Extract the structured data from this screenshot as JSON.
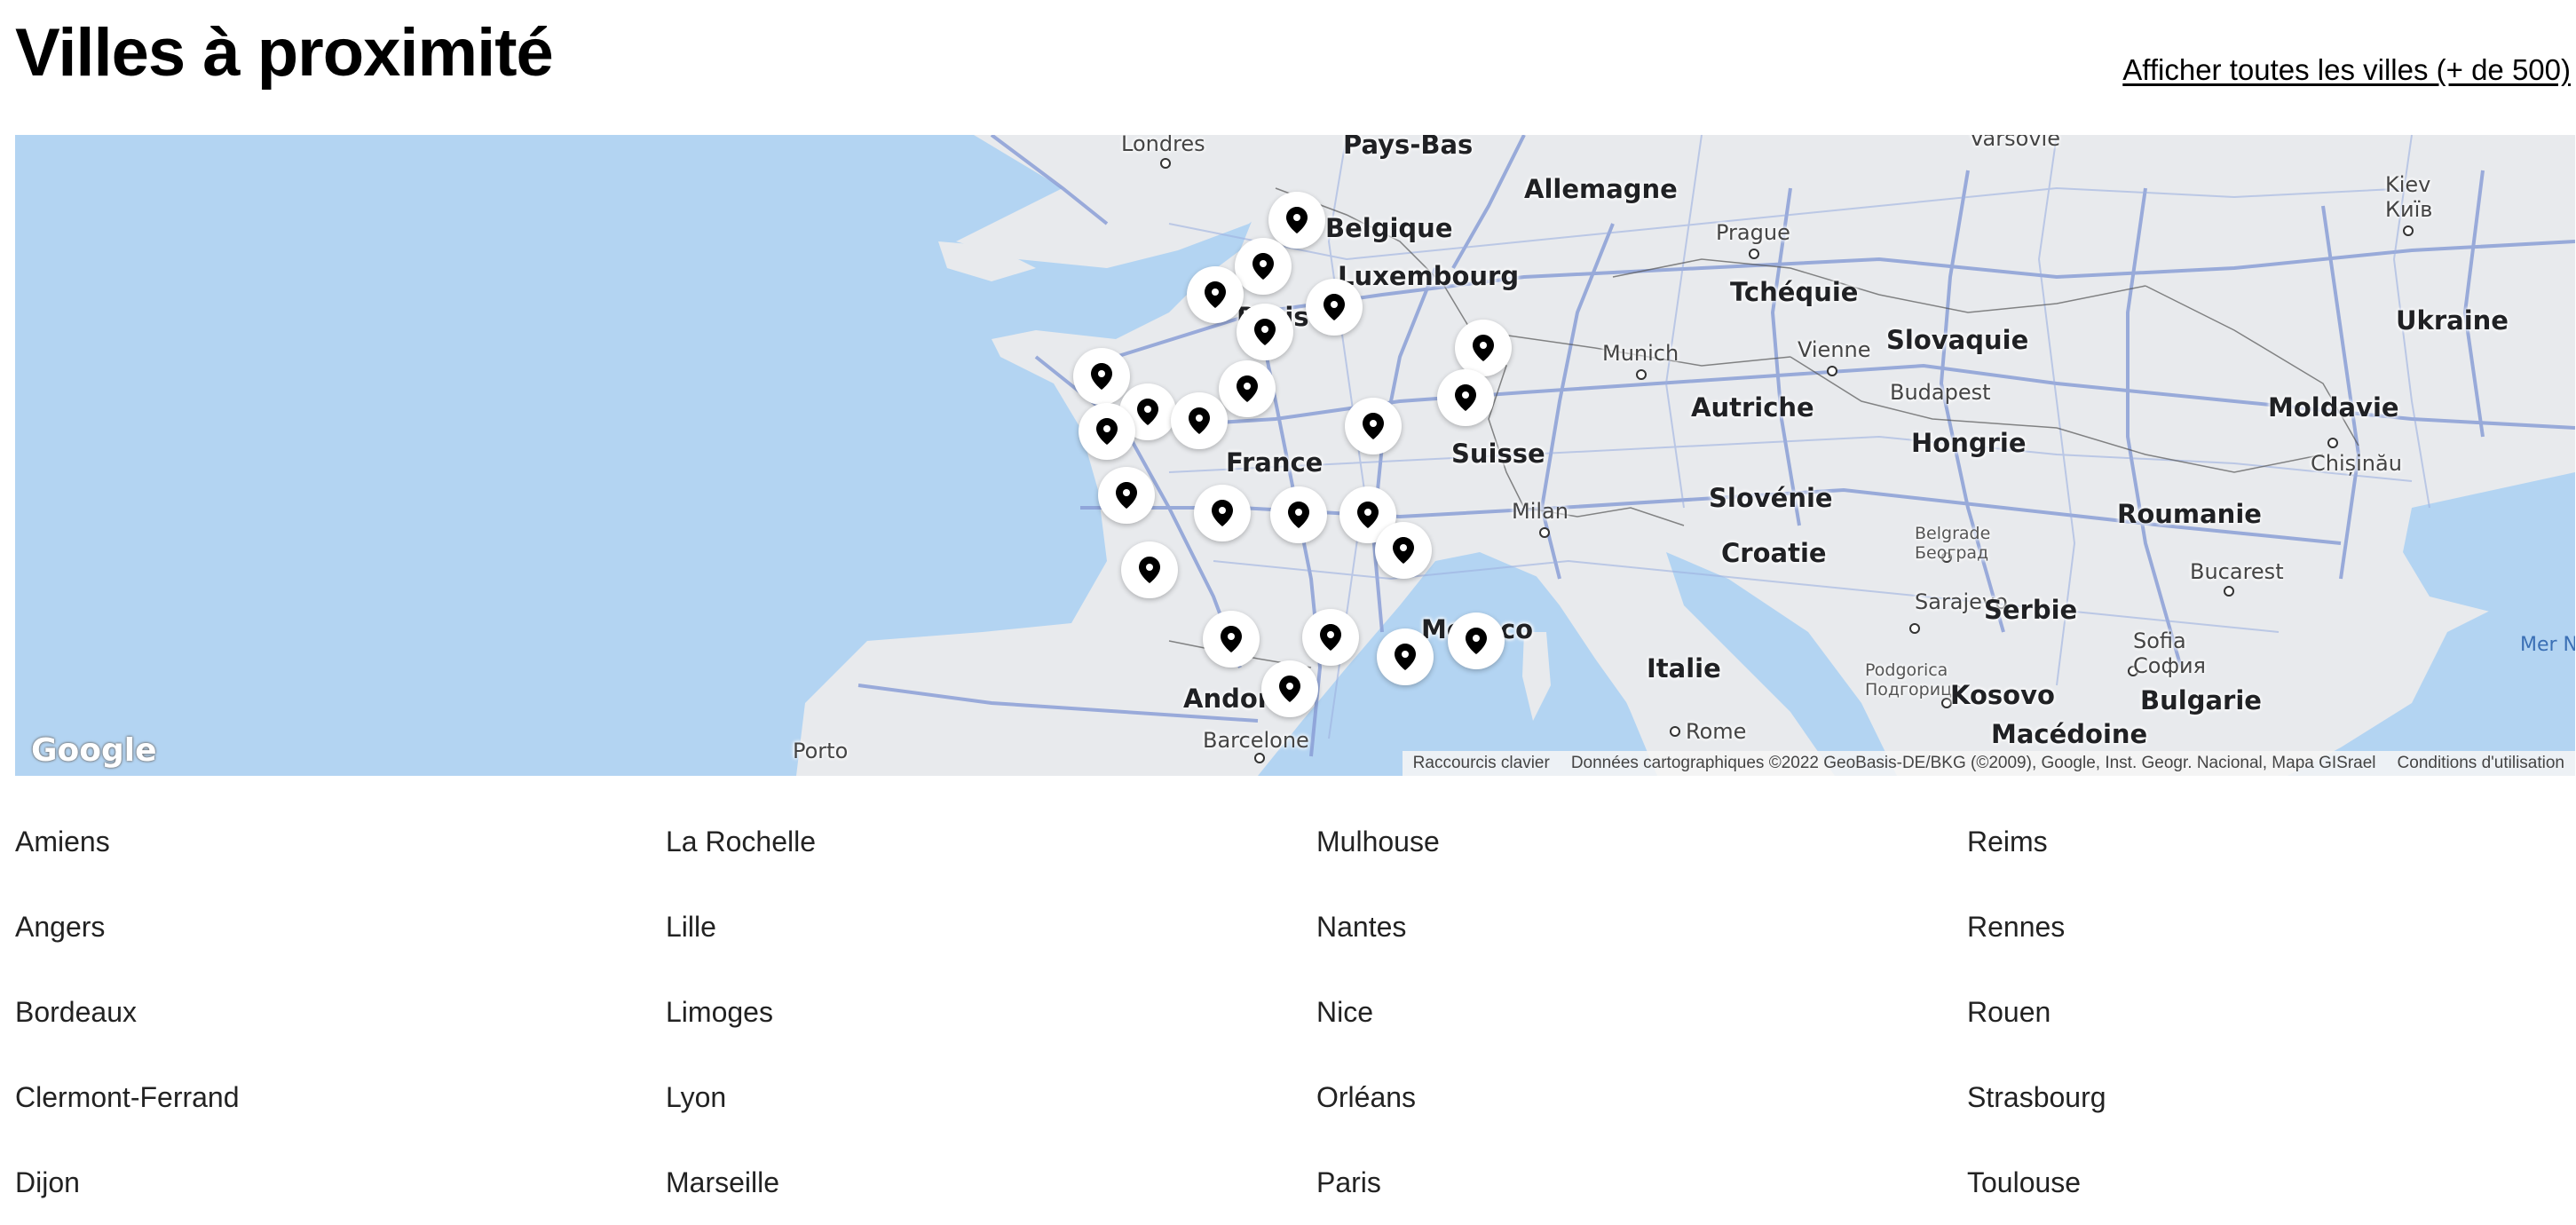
{
  "header": {
    "title": "Villes à proximité",
    "all_cities_link": "Afficher toutes les villes (+ de 500)"
  },
  "map": {
    "labels": {
      "pays_bas": "Pays-Bas",
      "londres": "Londres",
      "belgique": "Belgique",
      "allemagne": "Allemagne",
      "varsovie": "Varsovie",
      "kiev": "Kiev",
      "kiev_uk": "Київ",
      "luxembourg": "Luxembourg",
      "prague": "Prague",
      "tcheque": "Tchéquie",
      "ukraine": "Ukraine",
      "paris": "Paris",
      "slovaquie": "Slovaquie",
      "munich": "Munich",
      "vienne": "Vienne",
      "budapest": "Budapest",
      "autriche": "Autriche",
      "moldavie": "Moldavie",
      "suisse": "Suisse",
      "hongrie": "Hongrie",
      "chisinau": "Chișinău",
      "france": "France",
      "slovenie": "Slovénie",
      "milan": "Milan",
      "roumanie": "Roumanie",
      "croatie": "Croatie",
      "belgrade": "Belgrade",
      "belgrade_sr": "Београд",
      "bucarest": "Bucarest",
      "sarajevo": "Sarajevo",
      "serbie": "Serbie",
      "monaco": "Monaco",
      "sofia": "Sofia",
      "sofia_bg": "София",
      "italie": "Italie",
      "podgorica": "Podgorica",
      "podgorica_sr": "Подгорица",
      "kosovo": "Kosovo",
      "mer_noire": "Mer No",
      "bulgarie": "Bulgarie",
      "andorre": "Andorre",
      "rome": "Rome",
      "macedoine": "Macédoine",
      "porto": "Porto",
      "barcelone": "Barcelone"
    },
    "google_logo": "Google",
    "attribution": {
      "shortcuts": "Raccourcis clavier",
      "data": "Données cartographiques ©2022 GeoBasis-DE/BKG (©2009), Google, Inst. Geogr. Nacional, Mapa GISrael",
      "terms": "Conditions d'utilisation"
    },
    "pin_icon": "map-pin-icon"
  },
  "cities": [
    "Amiens",
    "La Rochelle",
    "Mulhouse",
    "Reims",
    "Angers",
    "Lille",
    "Nantes",
    "Rennes",
    "Bordeaux",
    "Limoges",
    "Nice",
    "Rouen",
    "Clermont-Ferrand",
    "Lyon",
    "Orléans",
    "Strasbourg",
    "Dijon",
    "Marseille",
    "Paris",
    "Toulouse"
  ],
  "colors": {
    "water": "#b3d4f2",
    "land": "#e8eaed",
    "roads": "#8b9fd6"
  }
}
